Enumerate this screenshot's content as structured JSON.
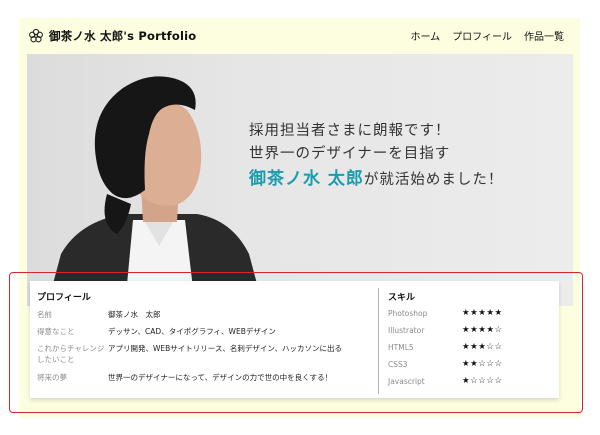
{
  "header": {
    "brand": "御茶ノ水 太郎's Portfolio",
    "logo_icon": "flower-icon",
    "nav": [
      "ホーム",
      "プロフィール",
      "作品一覧"
    ]
  },
  "hero": {
    "line1": "採用担当者さまに朗報です！",
    "line2": "世界一のデザイナーを目指す",
    "name": "御茶ノ水 太郎",
    "line3_suffix": "が就活始めました！",
    "accent_color": "#1a9cae"
  },
  "profile": {
    "title": "プロフィール",
    "rows": [
      {
        "label": "名前",
        "value": "御茶ノ水　太郎"
      },
      {
        "label": "得意なこと",
        "value": "デッサン、CAD、タイポグラフィ、WEBデザイン"
      },
      {
        "label": "これからチャレンジしたいこと",
        "value": "アプリ開発、WEBサイトリリース、名刺デザイン、ハッカソンに出る"
      },
      {
        "label": "将来の夢",
        "value": "世界一のデザイナーになって、デザインの力で世の中を良くする！"
      }
    ]
  },
  "skills": {
    "title": "スキル",
    "items": [
      {
        "name": "Photoshop",
        "rating": 5,
        "stars": "★★★★★"
      },
      {
        "name": "Illustrator",
        "rating": 4,
        "stars": "★★★★☆"
      },
      {
        "name": "HTML5",
        "rating": 3,
        "stars": "★★★☆☆"
      },
      {
        "name": "CSS3",
        "rating": 2,
        "stars": "★★☆☆☆"
      },
      {
        "name": "Javascript",
        "rating": 1,
        "stars": "★☆☆☆☆"
      }
    ]
  },
  "colors": {
    "page_bg": "#fdfde0",
    "highlight_border": "#d9262a"
  }
}
